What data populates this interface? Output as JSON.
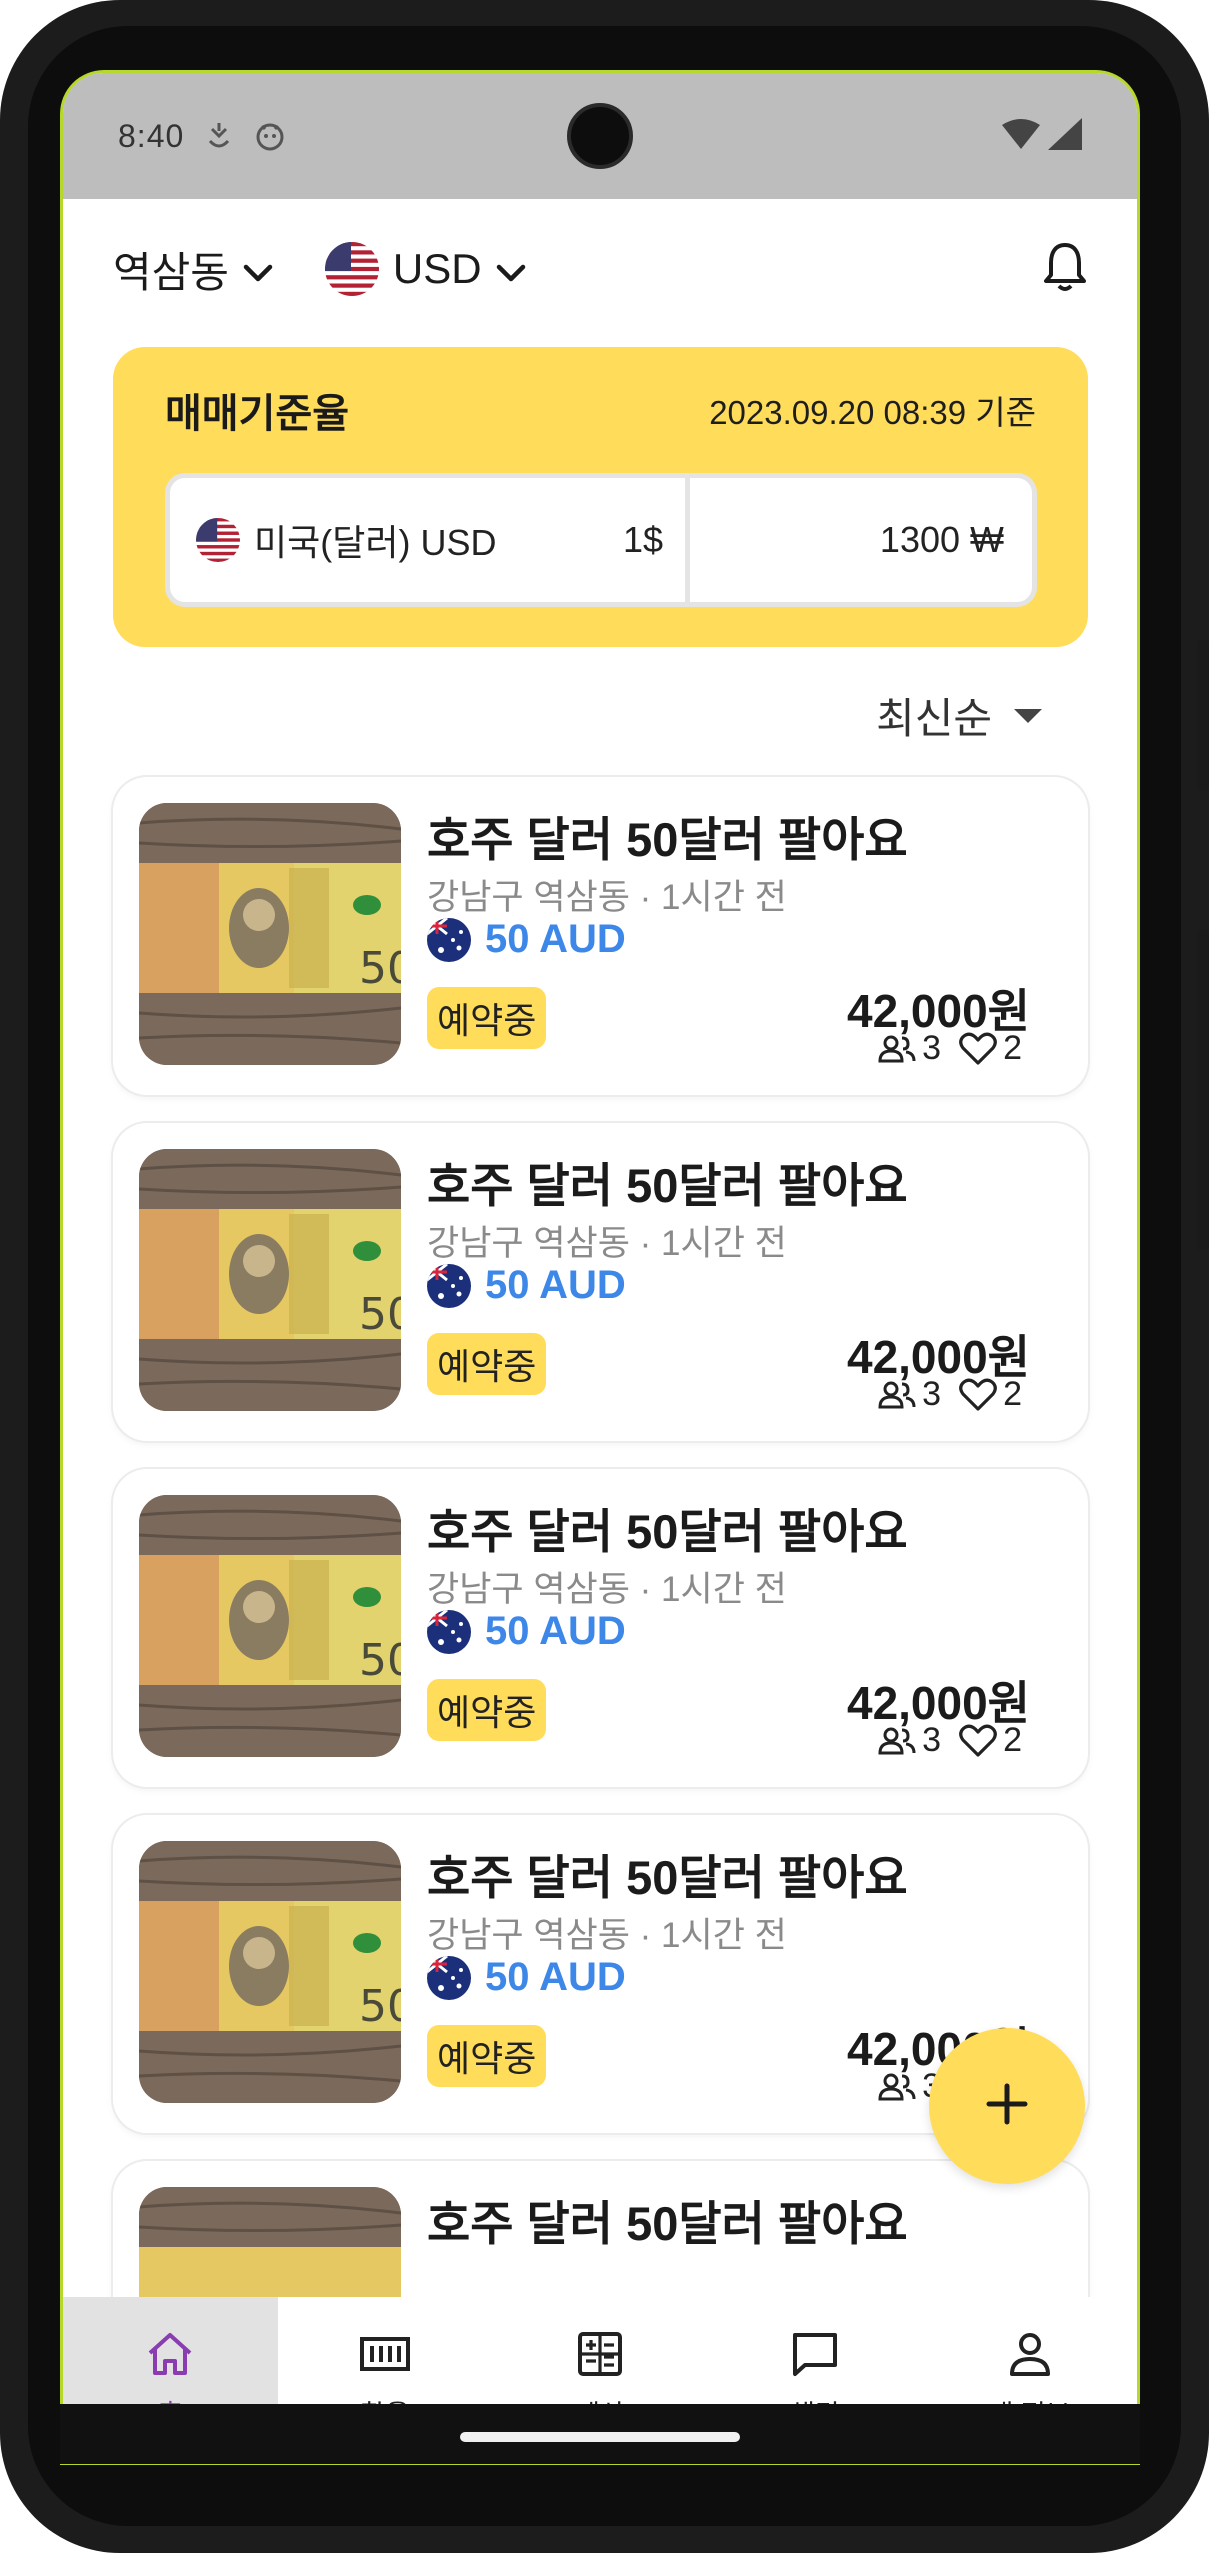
{
  "status_bar": {
    "time": "8:40"
  },
  "header": {
    "location": "역삼동",
    "currency": "USD",
    "us_flag_colors": [
      "#b22234",
      "#ffffff",
      "#3c3b6e"
    ]
  },
  "rate_card": {
    "title": "매매기준율",
    "date": "2023.09.20 08:39 기준",
    "currency_name": "미국(달러) USD",
    "unit": "1$",
    "krw_value": "1300 ₩",
    "bg_color": "#ffdc5a"
  },
  "sort": {
    "label": "최신순"
  },
  "listings": [
    {
      "title": "호주 달러 50달러 팔아요",
      "location": "강남구 역삼동 · 1시간 전",
      "amount": "50 AUD",
      "status": "예약중",
      "price": "42,000원",
      "chats": "3",
      "likes": "2"
    },
    {
      "title": "호주 달러 50달러 팔아요",
      "location": "강남구 역삼동 · 1시간 전",
      "amount": "50 AUD",
      "status": "예약중",
      "price": "42,000원",
      "chats": "3",
      "likes": "2"
    },
    {
      "title": "호주 달러 50달러 팔아요",
      "location": "강남구 역삼동 · 1시간 전",
      "amount": "50 AUD",
      "status": "예약중",
      "price": "42,000원",
      "chats": "3",
      "likes": "2"
    },
    {
      "title": "호주 달러 50달러 팔아요",
      "location": "강남구 역삼동 · 1시간 전",
      "amount": "50 AUD",
      "status": "예약중",
      "price": "42,000원",
      "chats": "3",
      "likes": "2"
    },
    {
      "title": "호주 달러 50달러 팔아요"
    }
  ],
  "nav": {
    "items": [
      {
        "label": "홈",
        "icon": "home-icon",
        "active": true
      },
      {
        "label": "환율",
        "icon": "money-icon"
      },
      {
        "label": "계산",
        "icon": "calculator-icon"
      },
      {
        "label": "채팅",
        "icon": "chat-icon"
      },
      {
        "label": "내 정보",
        "icon": "person-icon"
      }
    ],
    "active_color": "#8a3db0"
  },
  "accent_color": "#3d87e8"
}
